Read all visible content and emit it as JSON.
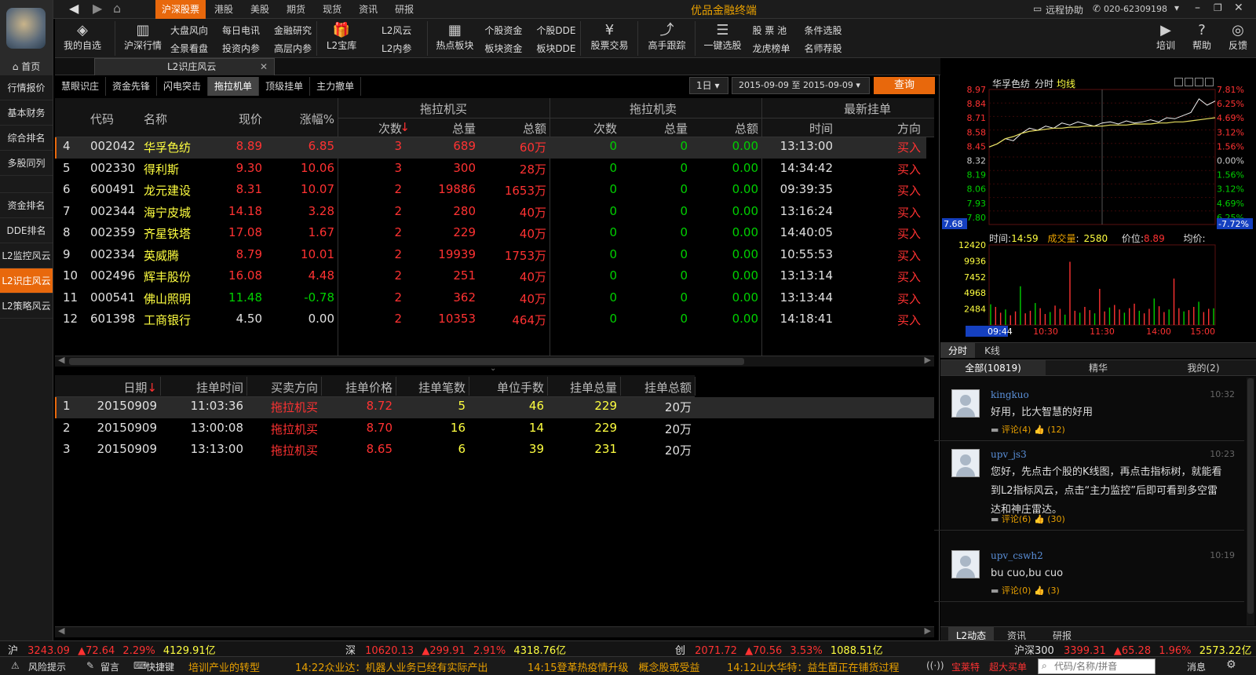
{
  "app": {
    "title": "优品金融终端",
    "remote_help": "远程协助",
    "phone": "020-62309198"
  },
  "top_tabs": [
    "沪深股票",
    "港股",
    "美股",
    "期货",
    "现货",
    "资讯",
    "研报"
  ],
  "toolbar": {
    "my_watch": "我的自选",
    "market": "沪深行情",
    "grid1": [
      "大盘风向",
      "每日电讯",
      "金融研究",
      "全景看盘",
      "投资内参",
      "高层内参"
    ],
    "l2_treasure": "L2宝库",
    "grid2": [
      "L2风云",
      "L2内参"
    ],
    "hot_sector": "热点板块",
    "grid3": [
      "个股资金",
      "个股DDE",
      "板块资金",
      "板块DDE"
    ],
    "stock_trade": "股票交易",
    "master_track": "高手跟踪",
    "one_pick": "一键选股",
    "grid4": [
      "股 票 池",
      "条件选股",
      "龙虎榜单",
      "名师荐股"
    ],
    "training": "培训",
    "help": "帮助",
    "feedback": "反馈"
  },
  "home_tab": "首页",
  "doc_tab": "L2识庄风云",
  "left_nav": [
    "行情报价",
    "基本财务",
    "综合排名",
    "多股同列",
    "资金排名",
    "DDE排名",
    "L2监控风云",
    "L2识庄风云",
    "L2策略风云"
  ],
  "left_nav_active": "L2识庄风云",
  "sub_tabs": [
    "慧眼识庄",
    "资金先锋",
    "闪电突击",
    "拖拉机单",
    "顶级挂单",
    "主力撤单"
  ],
  "sub_tab_active": "拖拉机单",
  "filter": {
    "period": "1日",
    "date_from": "2015-09-09",
    "to_label": "至",
    "date_to": "2015-09-09",
    "query": "查询"
  },
  "main_table": {
    "group_headers": [
      "拖拉机买",
      "拖拉机卖",
      "最新挂单"
    ],
    "headers": [
      "代码",
      "名称",
      "现价",
      "涨幅%",
      "次数",
      "总量",
      "总额",
      "次数",
      "总量",
      "总额",
      "时间",
      "方向"
    ],
    "rows": [
      [
        "4",
        "002042",
        "华孚色纺",
        "8.89",
        "6.85",
        "3",
        "689",
        "60万",
        "0",
        "0",
        "0.00",
        "13:13:00",
        "买入"
      ],
      [
        "5",
        "002330",
        "得利斯",
        "9.30",
        "10.06",
        "3",
        "300",
        "28万",
        "0",
        "0",
        "0.00",
        "14:34:42",
        "买入"
      ],
      [
        "6",
        "600491",
        "龙元建设",
        "8.31",
        "10.07",
        "2",
        "19886",
        "1653万",
        "0",
        "0",
        "0.00",
        "09:39:35",
        "买入"
      ],
      [
        "7",
        "002344",
        "海宁皮城",
        "14.18",
        "3.28",
        "2",
        "280",
        "40万",
        "0",
        "0",
        "0.00",
        "13:16:24",
        "买入"
      ],
      [
        "8",
        "002359",
        "齐星铁塔",
        "17.08",
        "1.67",
        "2",
        "229",
        "40万",
        "0",
        "0",
        "0.00",
        "14:40:05",
        "买入"
      ],
      [
        "9",
        "002334",
        "英威腾",
        "8.79",
        "10.01",
        "2",
        "19939",
        "1753万",
        "0",
        "0",
        "0.00",
        "10:55:53",
        "买入"
      ],
      [
        "10",
        "002496",
        "辉丰股份",
        "16.08",
        "4.48",
        "2",
        "251",
        "40万",
        "0",
        "0",
        "0.00",
        "13:13:14",
        "买入"
      ],
      [
        "11",
        "000541",
        "佛山照明",
        "11.48",
        "-0.78",
        "2",
        "362",
        "40万",
        "0",
        "0",
        "0.00",
        "13:13:44",
        "买入"
      ],
      [
        "12",
        "601398",
        "工商银行",
        "4.50",
        "0.00",
        "2",
        "10353",
        "464万",
        "0",
        "0",
        "0.00",
        "14:18:41",
        "买入"
      ]
    ]
  },
  "detail_table": {
    "headers": [
      "日期",
      "挂单时间",
      "买卖方向",
      "挂单价格",
      "挂单笔数",
      "单位手数",
      "挂单总量",
      "挂单总额"
    ],
    "rows": [
      [
        "1",
        "20150909",
        "11:03:36",
        "拖拉机买",
        "8.72",
        "5",
        "46",
        "229",
        "20万"
      ],
      [
        "2",
        "20150909",
        "13:00:08",
        "拖拉机买",
        "8.70",
        "16",
        "14",
        "229",
        "20万"
      ],
      [
        "3",
        "20150909",
        "13:13:00",
        "拖拉机买",
        "8.65",
        "6",
        "39",
        "231",
        "20万"
      ]
    ]
  },
  "chart_data": {
    "type": "line",
    "title": "华孚色纺",
    "mode": "分时",
    "avg_label": "均线",
    "price_ticks": [
      "8.97",
      "8.84",
      "8.71",
      "8.58",
      "8.45",
      "8.32",
      "8.19",
      "8.06",
      "7.93",
      "7.80"
    ],
    "pct_ticks": [
      "7.81%",
      "6.25%",
      "4.69%",
      "3.12%",
      "1.56%",
      "0.00%",
      "1.56%",
      "3.12%",
      "4.69%",
      "6.25%"
    ],
    "low_label": "7.68",
    "low_pct": "-7.72%",
    "ylim": [
      7.68,
      8.97
    ],
    "info": {
      "time_label": "时间",
      "time": "14:59",
      "vol_label": "成交量",
      "vol": "2580",
      "price_label": "价位",
      "price": "8.89",
      "avg_price_label": "均价"
    },
    "vol_ticks": [
      "12420",
      "9936",
      "7452",
      "4968",
      "2484"
    ],
    "x_ticks": [
      "09:44",
      "10:30",
      "11:30",
      "14:00",
      "15:00"
    ],
    "price_series": [
      8.42,
      8.45,
      8.5,
      8.48,
      8.55,
      8.6,
      8.58,
      8.62,
      8.6,
      8.65,
      8.63,
      8.66,
      8.64,
      8.62,
      8.65,
      8.66,
      8.64,
      8.67,
      8.65,
      8.66,
      8.68,
      8.66,
      8.7,
      8.69,
      8.72,
      8.75,
      8.88,
      8.82,
      8.86
    ],
    "avg_series": [
      8.42,
      8.45,
      8.5,
      8.52,
      8.55,
      8.57,
      8.58,
      8.59,
      8.6,
      8.6,
      8.61,
      8.61,
      8.62,
      8.62,
      8.62,
      8.63,
      8.63,
      8.63,
      8.64,
      8.64,
      8.64,
      8.65,
      8.65,
      8.66,
      8.66,
      8.67,
      8.68,
      8.69,
      8.7
    ],
    "volume_series": [
      3200,
      2800,
      1900,
      2400,
      1500,
      2100,
      6000,
      1800,
      2200,
      3400,
      2600,
      1700,
      2000,
      3000,
      2500,
      1600,
      9800,
      2200,
      1900,
      2800,
      2300,
      1800,
      5600,
      2100,
      2700,
      3100,
      2400,
      1900,
      2600,
      3300,
      2200,
      1800,
      2500,
      4100,
      2900,
      2000,
      2400,
      7200,
      2600,
      2100,
      2300,
      2800,
      3600,
      2000,
      2500,
      2580
    ]
  },
  "chart_tabs": [
    "分时",
    "K线"
  ],
  "comment_tabs": [
    "全部(10819)",
    "精华",
    "我的(2)"
  ],
  "comments": [
    {
      "user": "kingkuo",
      "time": "10:32",
      "text": "好用，比大智慧的好用",
      "comments": "评论(4)",
      "likes": "(12)"
    },
    {
      "user": "upv_js3",
      "time": "10:23",
      "text": "您好，先点击个股的K线图，再点击指标树，就能看到L2指标风云，点击“主力监控”后即可看到多空雷达和神庄雷达。",
      "comments": "评论(6)",
      "likes": "(30)"
    },
    {
      "user": "upv_cswh2",
      "time": "10:19",
      "text": "bu cuo,bu cuo",
      "comments": "评论(0)",
      "likes": "(3)"
    }
  ],
  "bottom_tabs": [
    "L2动态",
    "资讯",
    "研报"
  ],
  "indices": [
    {
      "name": "沪",
      "value": "3243.09",
      "change": "72.64",
      "pct": "2.29%",
      "amount": "4129.91亿"
    },
    {
      "name": "深",
      "value": "10620.13",
      "change": "299.91",
      "pct": "2.91%",
      "amount": "4318.76亿"
    },
    {
      "name": "创",
      "value": "2071.72",
      "change": "70.56",
      "pct": "3.53%",
      "amount": "1088.51亿"
    },
    {
      "name": "沪深300",
      "value": "3399.31",
      "change": "65.28",
      "pct": "1.96%",
      "amount": "2573.22亿"
    }
  ],
  "status": {
    "risk": "风险提示",
    "message": "留言",
    "shortcut": "快捷键",
    "news": [
      "培训产业的转型",
      "14:22众业达：机器人业务已经有实际产出",
      "14:15登革热疫情升级　概念股或受益",
      "14:12山大华特：益生菌正在铺货过程"
    ],
    "treasure": "宝莱特",
    "big_buy": "超大买单",
    "search_placeholder": "代码/名称/拼音",
    "msg": "消息"
  },
  "colors": {
    "accent": "#e8680c",
    "up": "#ff3232",
    "down": "#00d000",
    "name": "#ffff40"
  }
}
